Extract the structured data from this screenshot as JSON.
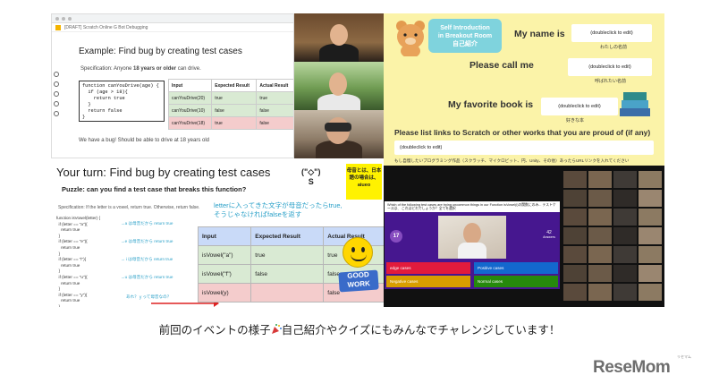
{
  "top_left_slide": {
    "app_name": "[DRAFT] Scratch Online G Bot Debugging",
    "title": "Example: Find bug by creating test cases",
    "spec_prefix": "Specification: Anyone ",
    "spec_bold": "18 years or older",
    "spec_suffix": " can drive.",
    "code": "function canYouDrive(age) {\n  if (age > 18){\n    return true\n  }\n  return false\n}",
    "table": {
      "headers": [
        "Input",
        "Expected Result",
        "Actual Result"
      ],
      "rows": [
        [
          "canYouDrive(20)",
          "true",
          "true"
        ],
        [
          "canYouDrive(10)",
          "false",
          "false"
        ],
        [
          "canYouDrive(18)",
          "true",
          "false"
        ]
      ]
    },
    "bug_note": "We have a bug! Should be able to drive at 18 years old"
  },
  "intro_slide": {
    "tab_title_line1": "Self Introduction",
    "tab_title_line2": "in Breakout Room",
    "tab_title_jp": "自己紹介",
    "name_label": "My name is",
    "name_field": "(doubleclick to edit)",
    "name_jp": "わたしの名前",
    "call_label": "Please call me",
    "call_field": "(doubleclick to edit)",
    "call_jp": "呼ばれたい名前",
    "book_label": "My favorite book is",
    "book_field": "(doubleclick to edit)",
    "book_jp": "好きな本",
    "links_label": "Please list links to Scratch or other works that you are proud of (if any)",
    "links_field": "(doubleclick to edit)",
    "links_jp": "もし自慢したいプログラミング作品（スクラッチ、マイクロビット、円、Unity、その他）あったらURLリンクを入れてください"
  },
  "bottom_left_slide": {
    "title": "Your turn: Find bug by creating test cases",
    "puzzle": "Puzzle: can you find a test case that breaks this function?",
    "spec": "Specification: If the letter is a vowel, return true. Otherwise, return false.",
    "code": "function isVowel(letter) {\n  if (letter == \"a\"){\n    return true\n  }\n  if (letter == \"e\"){\n    return true\n  }\n  if (letter == \"i\"){\n    return true\n  }\n  if (letter == \"u\"){\n    return true\n  }\n  if (letter == \"y\"){\n    return true\n  }\n  Return false",
    "code_note_1": "→a は母音だから return true",
    "code_note_2": "→e は母音だから return true",
    "code_note_3": "→ i は母音だから return true",
    "code_note_4": "→u は母音だから return true",
    "code_note_5": "あれ？ｙって母音なの？",
    "jp_note_line1": "letterに入ってきた文字が母音だったらtrue,",
    "jp_note_line2": "そうじゃなければfalseを返す",
    "emoticon": "(\"◇\")",
    "emoticon_sub": "S",
    "yellow_note": "母音とは、日本語の場合は、aiueo",
    "table": {
      "headers": [
        "Input",
        "Expected Result",
        "Actual Result"
      ],
      "rows": [
        [
          "isVowel(\"a\")",
          "true",
          "true"
        ],
        [
          "isVowel(\"f\")",
          "false",
          "false"
        ],
        [
          "isVowel(y)",
          "",
          "false"
        ]
      ]
    },
    "sticker": "GOOD WORK"
  },
  "quiz": {
    "question": "Which of the following test cases are trying uncommon things in our Function isVowel(i)の関数にのみ... テストケースは、 これはどれでしょうか？全てを選択",
    "timer": "17",
    "answers_count": "42",
    "answers_label": "Answers",
    "answer_1": "edge cases",
    "answer_2": "Positive cases",
    "answer_3": "Negative cases",
    "answer_4": "Normal cases"
  },
  "caption": {
    "before": "前回のイベントの様子",
    "after": "自己紹介やクイズにもみんなでチャレンジしています！"
  },
  "logo": {
    "text": "ReseMom",
    "small": "リセマム"
  },
  "colors": {
    "intro_bg": "#fbf3a8",
    "intro_tab": "#7fd3dd",
    "quiz_purple": "#46178f",
    "ans_red": "#e21b3c",
    "ans_blue": "#1368ce",
    "ans_yellow": "#d89e00",
    "ans_green": "#26890c"
  }
}
